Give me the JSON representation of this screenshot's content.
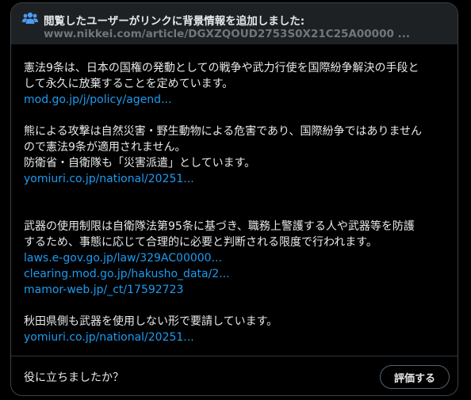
{
  "header": {
    "icon": "users-icon",
    "title": "閲覧したユーザーがリンクに背景情報を追加しました:",
    "url": "www.nikkei.com/article/DGXZQOUD2753S0X21C25A00000 ..."
  },
  "note": {
    "paragraph1": {
      "lines": [
        "憲法9条は、日本の国権の発動としての戦争や武力行使を国際紛争解決の手段と",
        "して永久に放棄することを定めています。"
      ],
      "links": [
        "mod.go.jp/j/policy/agend..."
      ]
    },
    "paragraph2": {
      "lines": [
        "熊による攻撃は自然災害・野生動物による危害であり、国際紛争ではありません",
        "ので憲法9条が適用されません。",
        "防衛省・自衛隊も「災害派遣」としています。"
      ],
      "links": [
        "yomiuri.co.jp/national/20251..."
      ]
    },
    "paragraph3": {
      "lines": [
        "武器の使用制限は自衛隊法第95条に基づき、職務上警護する人や武器等を防護",
        "するため、事態に応じて合理的に必要と判断される限度で行われます。"
      ],
      "links": [
        "laws.e-gov.go.jp/law/329AC00000...",
        "clearing.mod.go.jp/hakusho_data/2...",
        "mamor-web.jp/_ct/17592723"
      ]
    },
    "paragraph4": {
      "lines": [
        "秋田県側も武器を使用しない形で要請しています。"
      ],
      "links": [
        "yomiuri.co.jp/national/20251..."
      ]
    }
  },
  "footer": {
    "question": "役に立ちましたか？",
    "rate_label": "評価する"
  },
  "colors": {
    "text": "#e7e9ea",
    "muted": "#71767b",
    "link": "#1d9bf0",
    "header_bg": "#1e2124",
    "border": "#3e4144"
  }
}
